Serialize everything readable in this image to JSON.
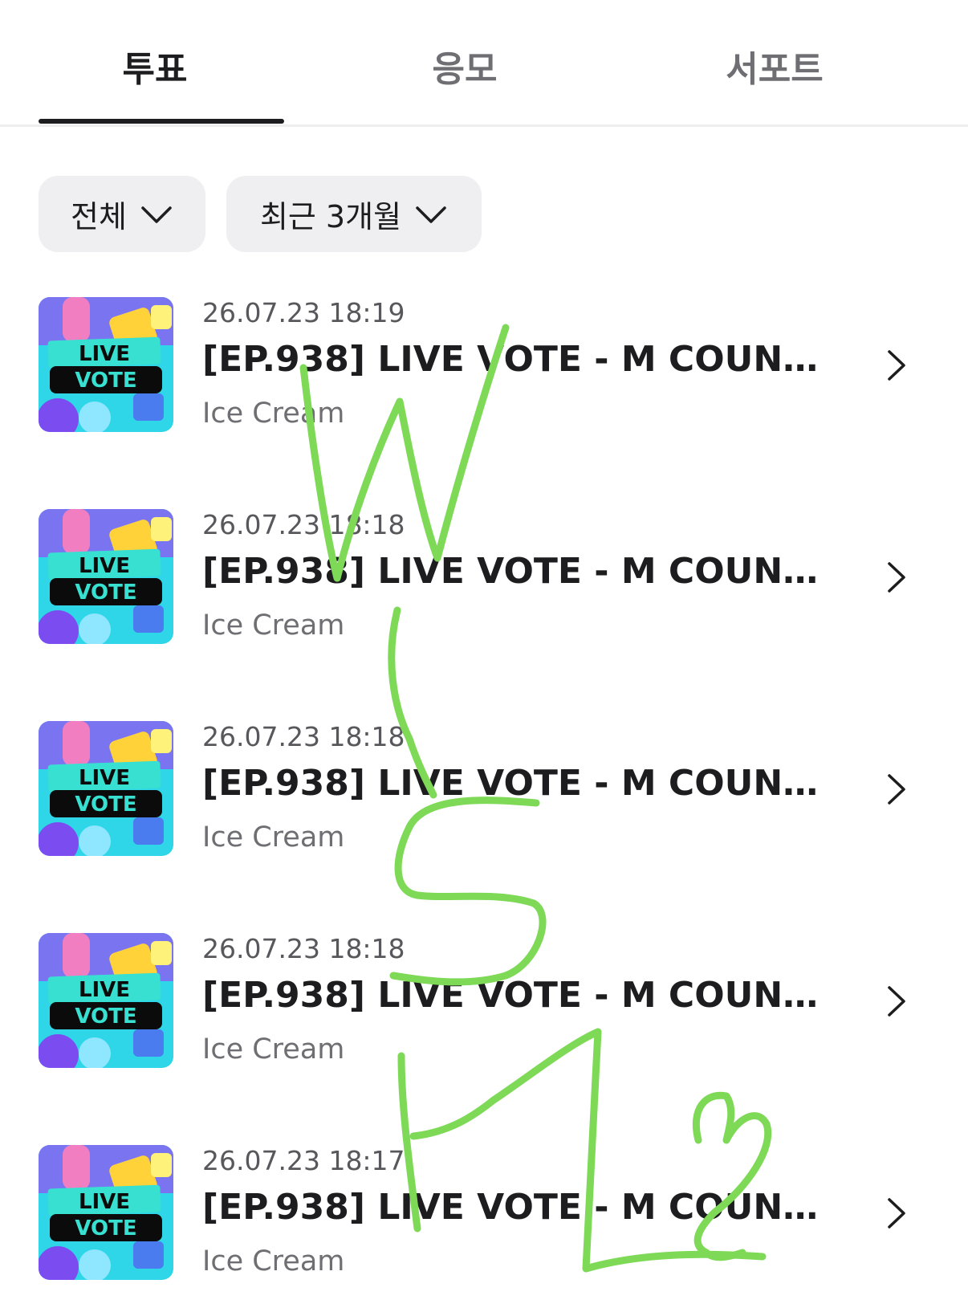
{
  "tabs": [
    {
      "label": "투표",
      "active": true
    },
    {
      "label": "응모",
      "active": false
    },
    {
      "label": "서포트",
      "active": false
    }
  ],
  "filters": {
    "category": "전체",
    "period": "최근 3개월"
  },
  "thumbnail": {
    "line1": "LIVE",
    "line2": "VOTE"
  },
  "items": [
    {
      "date": "26.07.23 18:19",
      "title": "[EP.938] LIVE VOTE - M COUNTD...",
      "artist": "Ice Cream"
    },
    {
      "date": "26.07.23 18:18",
      "title": "[EP.938] LIVE VOTE - M COUNTD...",
      "artist": "Ice Cream"
    },
    {
      "date": "26.07.23 18:18",
      "title": "[EP.938] LIVE VOTE - M COUNTD...",
      "artist": "Ice Cream"
    },
    {
      "date": "26.07.23 18:18",
      "title": "[EP.938] LIVE VOTE - M COUNTD...",
      "artist": "Ice Cream"
    },
    {
      "date": "26.07.23 18:17",
      "title": "[EP.938] LIVE VOTE - M COUNTD...",
      "artist": "Ice Cream"
    }
  ],
  "colors": {
    "text_primary": "#1d1d1f",
    "text_secondary": "#6e6e73",
    "filter_bg": "#efeff1",
    "scribble": "#7ed957",
    "thumb_bg": "#2fd6e8",
    "thumb_banner": "#37e0d0"
  },
  "icons": {
    "filter_chevron": "chevron-down-icon",
    "row_arrow": "chevron-right-icon"
  }
}
